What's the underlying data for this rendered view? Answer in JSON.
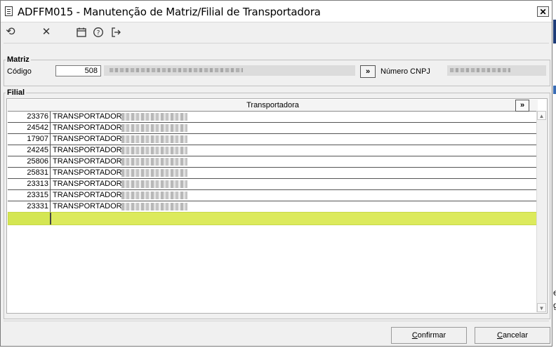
{
  "window": {
    "title": "ADFFM015 - Manutenção de Matriz/Filial de Transportadora",
    "close_label": "✕",
    "title_icon": "document-icon"
  },
  "toolbar": {
    "icons": [
      "undo-icon",
      "cancel-icon",
      "calendar-icon",
      "help-icon",
      "exit-icon"
    ],
    "glyphs": {
      "undo": "⟲",
      "cancel": "✕",
      "calendar": "▭",
      "help": "?",
      "exit": "⇥"
    }
  },
  "matriz": {
    "legend": "Matriz",
    "codigo_label": "Código",
    "codigo_value": "508",
    "lookup_button": "»",
    "cnpj_label": "Número CNPJ"
  },
  "filial": {
    "legend": "Filial",
    "column_header": "Transportadora",
    "header_button": "»",
    "rows": [
      {
        "code": "23376",
        "name": "TRANSPORTADORA"
      },
      {
        "code": "24542",
        "name": "TRANSPORTADORA"
      },
      {
        "code": "17907",
        "name": "TRANSPORTADORA"
      },
      {
        "code": "24245",
        "name": "TRANSPORTADORA"
      },
      {
        "code": "25806",
        "name": "TRANSPORTADORA"
      },
      {
        "code": "25831",
        "name": "TRANSPORTADORA"
      },
      {
        "code": "23313",
        "name": "TRANSPORTADORA"
      },
      {
        "code": "23315",
        "name": "TRANSPORTADORA"
      },
      {
        "code": "23331",
        "name": "TRANSPORTADORA"
      }
    ],
    "new_row_highlight": "#dcea5c"
  },
  "footer": {
    "confirm": {
      "pre": "",
      "ul": "C",
      "post": "onfirmar"
    },
    "cancel": {
      "pre": "",
      "ul": "C",
      "post": "ancelar"
    }
  },
  "background_fragments": {
    "e": "e",
    "g": "g"
  }
}
